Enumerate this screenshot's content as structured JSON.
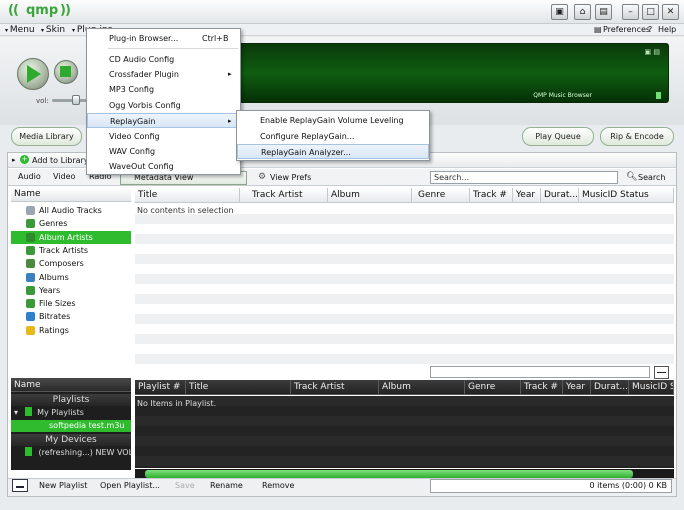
{
  "app": {
    "name": "qmp",
    "logo_left": "((",
    "logo_right": "))",
    "accent_color": "#2ebc2e"
  },
  "menubar": {
    "items": [
      "Menu",
      "Skin",
      "Plug-ins"
    ],
    "right_items": [
      "Preferences",
      "Help"
    ]
  },
  "player": {
    "volume_label": "vol:",
    "volume_level": 0.6,
    "display_label": "QMP Music Browser"
  },
  "toolbar": {
    "media_library": "Media Library",
    "play_queue": "Play Queue",
    "rip_encode": "Rip & Encode"
  },
  "library": {
    "add_to_library": "Add to Library",
    "tabs": [
      "Audio",
      "Video",
      "Radio"
    ],
    "view_mode": "Metadata View",
    "view_prefs": "View Prefs",
    "search_placeholder": "Search...",
    "search_button": "Search"
  },
  "tree": {
    "header": "Name",
    "items": [
      {
        "label": "All Audio Tracks",
        "color": "#9aa7b2"
      },
      {
        "label": "Genres",
        "color": "#3a9a3a"
      },
      {
        "label": "Album Artists",
        "color": "#2e8a2e"
      },
      {
        "label": "Track Artists",
        "color": "#3a9a3a"
      },
      {
        "label": "Composers",
        "color": "#4a8a3a"
      },
      {
        "label": "Albums",
        "color": "#3a7fbf"
      },
      {
        "label": "Years",
        "color": "#3a9a3a"
      },
      {
        "label": "File Sizes",
        "color": "#3a9a3a"
      },
      {
        "label": "Bitrates",
        "color": "#2f7fcf"
      },
      {
        "label": "Ratings",
        "color": "#e6b818"
      }
    ],
    "selected_index": 2
  },
  "playlists": {
    "header": "Name",
    "section_playlists": "Playlists",
    "my_playlists": "My Playlists",
    "playlist_file": "softpedia test.m3u",
    "section_devices": "My Devices",
    "device_item": "(refreshing...) NEW VOLUME"
  },
  "track_grid": {
    "columns": [
      "Title",
      "Track Artist",
      "Album",
      "Genre",
      "Track #",
      "Year",
      "Durat...",
      "MusicID Status"
    ],
    "empty_text": "No contents in selection"
  },
  "playlist_grid": {
    "columns": [
      "Playlist #",
      "Title",
      "Track Artist",
      "Album",
      "Genre",
      "Track #",
      "Year",
      "Durat...",
      "MusicID S"
    ],
    "empty_text": "No Items in Playlist."
  },
  "bottombar": {
    "new_playlist": "New Playlist",
    "open_playlist": "Open Playlist...",
    "save": "Save",
    "rename": "Rename",
    "remove": "Remove",
    "status": "0 items (0:00) 0 KB"
  },
  "plugin_menu": {
    "browser": "Plug-in Browser...",
    "browser_shortcut": "Ctrl+B",
    "items": [
      "CD Audio Config",
      "Crossfader Plugin",
      "MP3 Config",
      "Ogg Vorbis Config",
      "ReplayGain",
      "Video Config",
      "WAV Config",
      "WaveOut Config"
    ]
  },
  "replaygain_menu": {
    "items": [
      "Enable ReplayGain Volume Leveling",
      "Configure ReplayGain...",
      "ReplayGain Analyzer..."
    ]
  }
}
